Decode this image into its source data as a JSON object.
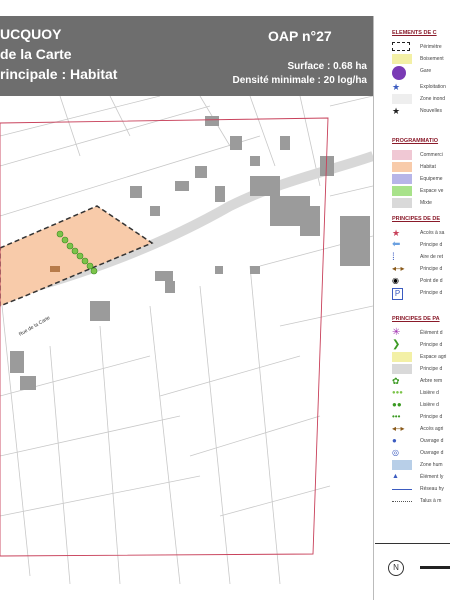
{
  "header": {
    "title_line1": "UCQUOY",
    "title_line2": "de la Carte",
    "title_line3": "rincipale : Habitat",
    "oap_number": "OAP n°27",
    "surface": "Surface : 0.68 ha",
    "density": "Densité minimale : 20 log/ha"
  },
  "map": {
    "street_label": "Rue de la Carte",
    "colors": {
      "habitat": "#f8cbaa",
      "boundary": "#c8405a",
      "building": "#9b9b9b",
      "hedge": "#7cc44a"
    }
  },
  "legend": {
    "sections": [
      {
        "title": "ELEMENTS DE C",
        "items": [
          {
            "icon": "dashed-rect-icon",
            "label": "Périmètre"
          },
          {
            "icon": "yellow-rect-icon",
            "label": "Boisement"
          },
          {
            "icon": "gare-icon",
            "label": "Gare"
          },
          {
            "icon": "blue-star-icon",
            "label": "Exploitation"
          },
          {
            "icon": "zone-icon",
            "label": "Zone inond"
          },
          {
            "icon": "black-star-icon",
            "label": "Nouvelles"
          }
        ]
      },
      {
        "title": "PROGRAMMATIO",
        "items": [
          {
            "icon": "pink-rect-icon",
            "label": "Commerci"
          },
          {
            "icon": "orange-rect-icon",
            "label": "Habitat"
          },
          {
            "icon": "purple-rect-icon",
            "label": "Equipeme"
          },
          {
            "icon": "green-rect-icon",
            "label": "Espace ve"
          },
          {
            "icon": "grey-rect-icon",
            "label": "Mixte"
          }
        ]
      },
      {
        "title": "PRINCIPES DE DE",
        "items": [
          {
            "icon": "red-star-icon",
            "label": "Accès à sa"
          },
          {
            "icon": "blue-arrow-icon",
            "label": "Principe d"
          },
          {
            "icon": "blue-dots-icon",
            "label": "Aire de ret"
          },
          {
            "icon": "brown-arrow-icon",
            "label": "Principe d"
          },
          {
            "icon": "point-icon",
            "label": "Point de d"
          },
          {
            "icon": "parking-icon",
            "label": "Principe d"
          }
        ]
      },
      {
        "title": "PRINCIPES DE PA",
        "items": [
          {
            "icon": "purple-asterisk-icon",
            "label": "Élément d"
          },
          {
            "icon": "green-chevron-icon",
            "label": "Principe d"
          },
          {
            "icon": "yellow-rect-icon",
            "label": "Espace agri"
          },
          {
            "icon": "grey-rect-icon",
            "label": "Principe d"
          },
          {
            "icon": "green-circle-icon",
            "label": "Arbre rem"
          },
          {
            "icon": "hedge-icon",
            "label": "Lisière d"
          },
          {
            "icon": "double-tree-icon",
            "label": "Lisière d"
          },
          {
            "icon": "three-dots-icon",
            "label": "Principe d"
          },
          {
            "icon": "brown-double-arrow-icon",
            "label": "Accès agri"
          },
          {
            "icon": "blue-circle-icon",
            "label": "Ouvrage d"
          },
          {
            "icon": "blue-ring-icon",
            "label": "Ouvrage d"
          },
          {
            "icon": "blue-rect-icon",
            "label": "Zone hum"
          },
          {
            "icon": "blue-triangle-icon",
            "label": "Élément ly"
          },
          {
            "icon": "blue-line-icon",
            "label": "Réseau hy"
          },
          {
            "icon": "dotted-line-icon",
            "label": "Talus à m"
          }
        ]
      }
    ]
  }
}
